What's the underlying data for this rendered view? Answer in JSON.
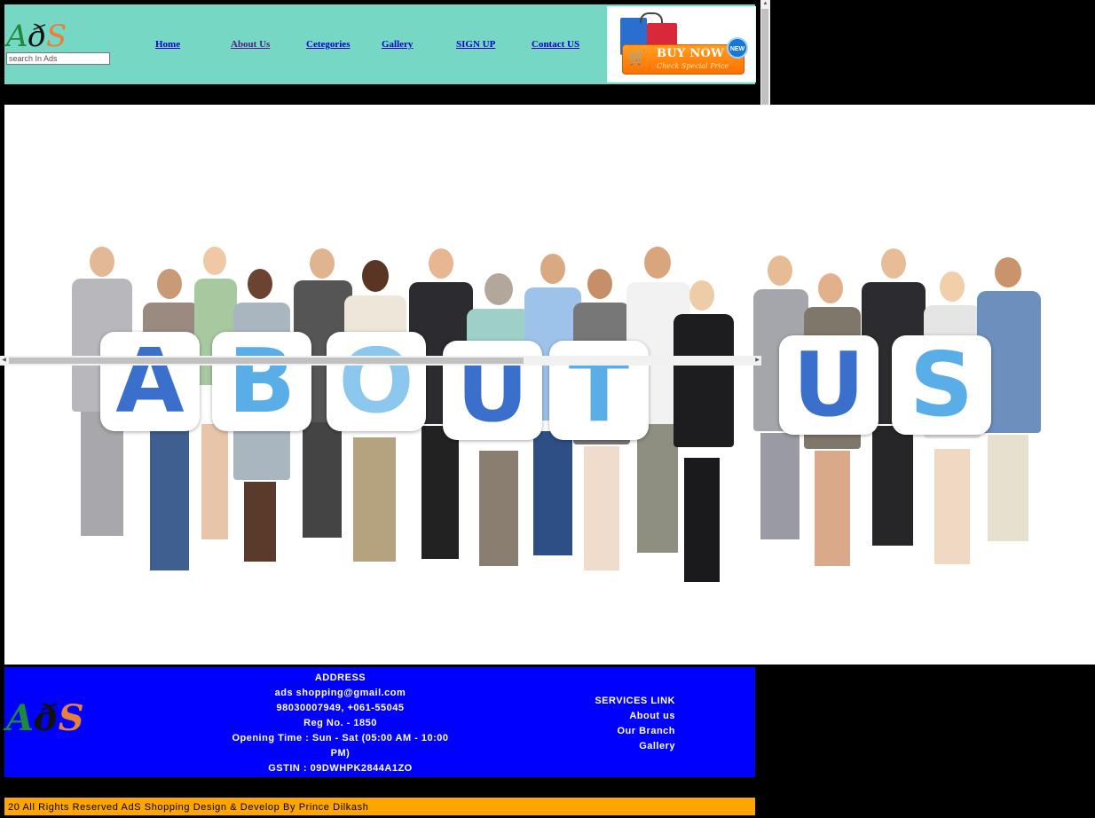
{
  "header": {
    "logo": {
      "l1": "A",
      "l2": "ð",
      "l3": "S"
    },
    "search_placeholder": "search In Ads",
    "nav": [
      {
        "label": "Home"
      },
      {
        "label": "About Us"
      },
      {
        "label": "Cetegories"
      },
      {
        "label": "Gallery"
      },
      {
        "label": "SIGN UP"
      },
      {
        "label": "Contact US"
      }
    ],
    "buy_now": {
      "title": "BUY NOW",
      "subtitle": "Check Special Price",
      "badge": "NEW"
    }
  },
  "hero": {
    "letters": [
      "A",
      "B",
      "O",
      "U",
      "T",
      "U",
      "S"
    ]
  },
  "footer": {
    "logo": {
      "l1": "A",
      "l2": "ð",
      "l3": "S"
    },
    "address": {
      "heading": "ADDRESS",
      "email": "ads shopping@gmail.com",
      "phone": "98030007949, +061-55045",
      "reg": "Reg No. - 1850",
      "hours": "Opening Time : Sun - Sat (05:00 AM - 10:00 PM)",
      "gstin": "GSTIN : 09DWHPK2844A1ZO"
    },
    "services": {
      "heading": "SERVICES LINK",
      "links": [
        "About us",
        "Our Branch",
        "Gallery"
      ]
    }
  },
  "copyright": "20 All Rights Reserved AdS Shopping Design & Develop By Prince Dilkash",
  "colors": {
    "header_bg": "#76d7c4",
    "footer_bg": "#0000ff",
    "copyright_bg": "#ffa500",
    "letter_dark_blue": "#3a6fcc",
    "letter_light_blue": "#5aaee8",
    "letter_pale_blue": "#8cc8ee"
  }
}
